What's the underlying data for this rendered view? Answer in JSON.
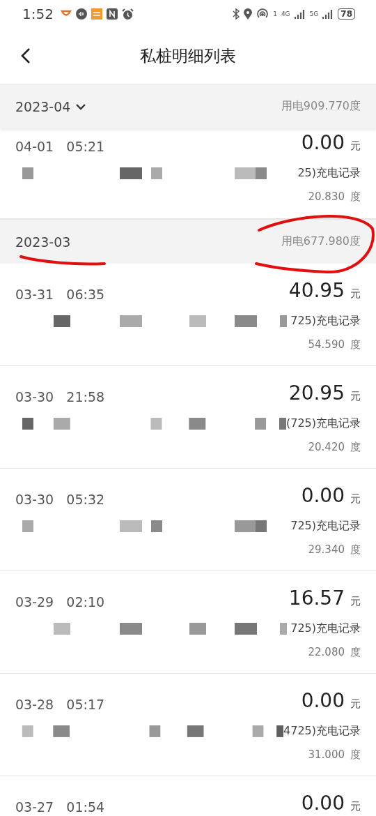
{
  "status_bar": {
    "time": "1:52",
    "sim_1": "1",
    "network_1": "4G",
    "network_2": "5G",
    "battery": "78"
  },
  "header": {
    "title": "私桩明细列表"
  },
  "months": [
    {
      "month": "2023-04",
      "kind": "picker",
      "usage": "用电909.770度",
      "records": [
        {
          "date": "04-01",
          "time": "05:21",
          "amount": "0.00",
          "unit": "元",
          "description": "25)充电记录",
          "energy": "20.830",
          "energy_unit": "度"
        }
      ]
    },
    {
      "month": "2023-03",
      "kind": "plain",
      "usage": "用电677.980度",
      "records": [
        {
          "date": "03-31",
          "time": "06:35",
          "amount": "40.95",
          "unit": "元",
          "description": "725)充电记录",
          "energy": "54.590",
          "energy_unit": "度"
        },
        {
          "date": "03-30",
          "time": "21:58",
          "amount": "20.95",
          "unit": "元",
          "description": "(725)充电记录",
          "energy": "20.420",
          "energy_unit": "度"
        },
        {
          "date": "03-30",
          "time": "05:32",
          "amount": "0.00",
          "unit": "元",
          "description": "725)充电记录",
          "energy": "29.340",
          "energy_unit": "度"
        },
        {
          "date": "03-29",
          "time": "02:10",
          "amount": "16.57",
          "unit": "元",
          "description": "725)充电记录",
          "energy": "22.080",
          "energy_unit": "度"
        },
        {
          "date": "03-28",
          "time": "05:17",
          "amount": "0.00",
          "unit": "元",
          "description": "4725)充电记录",
          "energy": "31.000",
          "energy_unit": "度"
        },
        {
          "date": "03-27",
          "time": "01:54",
          "amount": "0.00",
          "unit": "元"
        }
      ]
    }
  ]
}
